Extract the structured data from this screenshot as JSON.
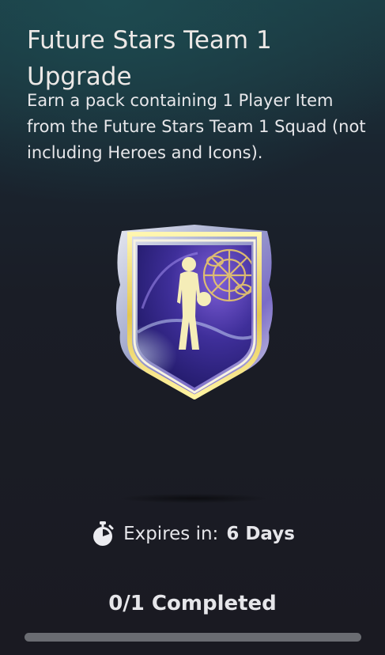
{
  "objective": {
    "title": "Future Stars Team 1 Upgrade",
    "description": "Earn a pack containing 1 Player Item from the Future Stars Team 1 Squad (not including Heroes and Icons).",
    "reward_icon": "future-stars-player-badge-icon",
    "expiry": {
      "icon": "stopwatch-icon",
      "label": "Expires in:",
      "value": "6 Days"
    },
    "progress": {
      "label": "0/1 Completed",
      "completed": 0,
      "total": 1
    }
  },
  "colors": {
    "badge_gold": "#f1e6a0",
    "badge_purple": "#4b3ba8",
    "badge_silver": "#d9dde8",
    "progress_track": "#6a6c72"
  }
}
